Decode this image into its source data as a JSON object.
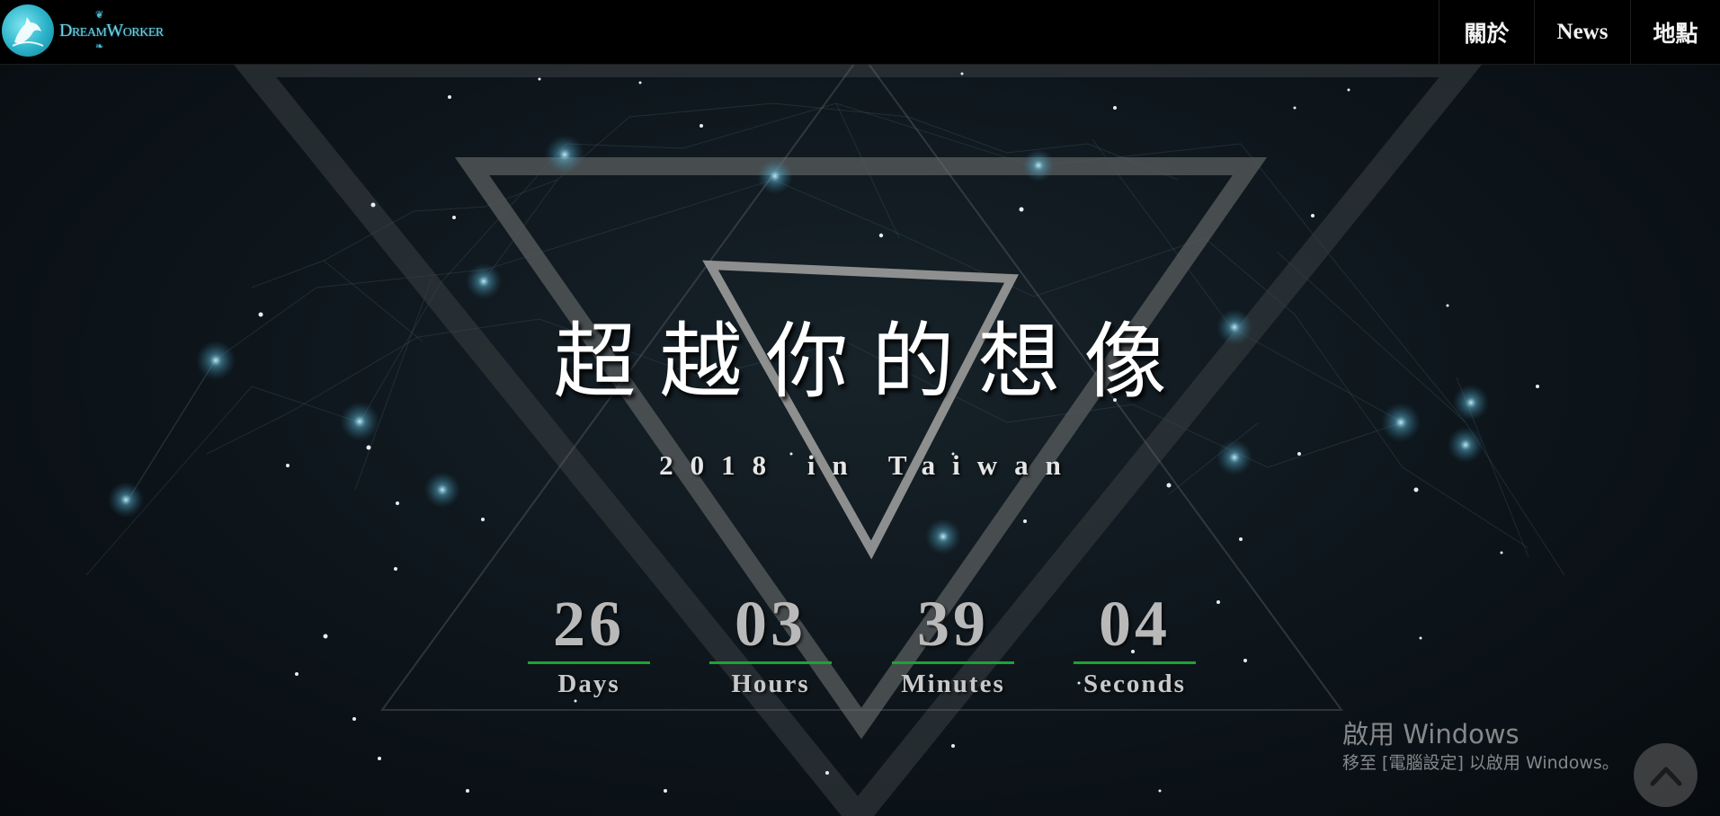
{
  "header": {
    "logo_text": "DreamWorker",
    "nav": [
      {
        "label": "關於"
      },
      {
        "label": "News"
      },
      {
        "label": "地點"
      }
    ]
  },
  "hero": {
    "title": "超越你的想像",
    "subtitle": "2018 in Taiwan"
  },
  "countdown": {
    "units": [
      {
        "value": "26",
        "label": "Days"
      },
      {
        "value": "03",
        "label": "Hours"
      },
      {
        "value": "39",
        "label": "Minutes"
      },
      {
        "value": "04",
        "label": "Seconds"
      }
    ],
    "accent_color": "#1fa233"
  },
  "windows_watermark": {
    "title": "啟用 Windows",
    "subtitle": "移至 [電腦設定] 以啟用 Windows。"
  },
  "scroll_top": {
    "icon": "chevron-up-icon"
  }
}
